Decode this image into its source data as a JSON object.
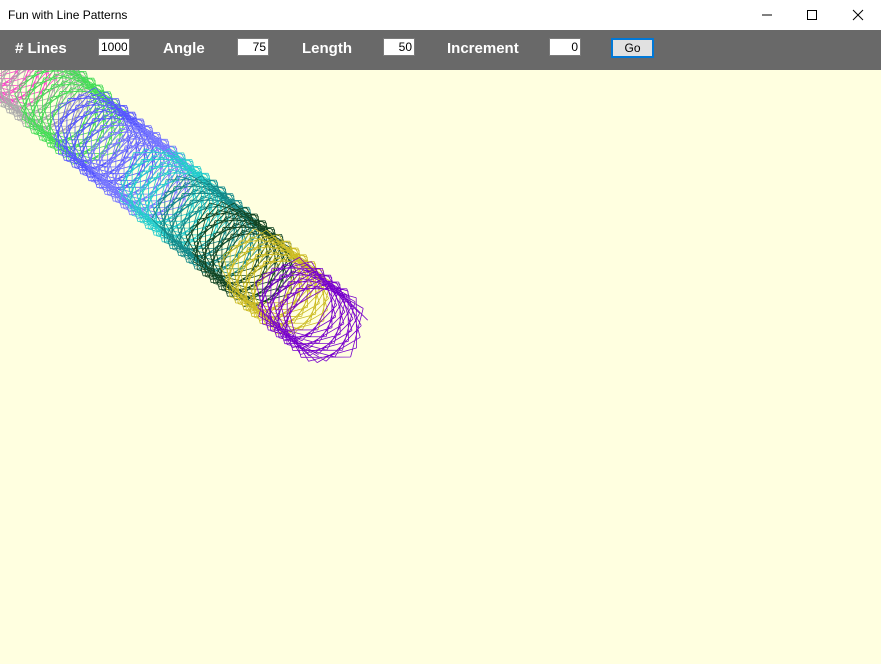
{
  "window": {
    "title": "Fun with Line Patterns",
    "minimize_icon": "minimize-icon",
    "maximize_icon": "maximize-icon",
    "close_icon": "close-icon"
  },
  "toolbar": {
    "lines_label": "# Lines",
    "lines_value": "1000",
    "angle_label": "Angle",
    "angle_value": "75",
    "length_label": "Length",
    "length_value": "50",
    "increment_label": "Increment",
    "increment_value": "0",
    "go_label": "Go"
  },
  "canvas": {
    "background": "#ffffe0",
    "pattern_colors": [
      "#ff44cc",
      "#aaaaaa",
      "#44dd55",
      "#5555ff",
      "#7777ff",
      "#22cccc",
      "#118888",
      "#114422",
      "#ccbb22",
      "#7700cc"
    ]
  }
}
